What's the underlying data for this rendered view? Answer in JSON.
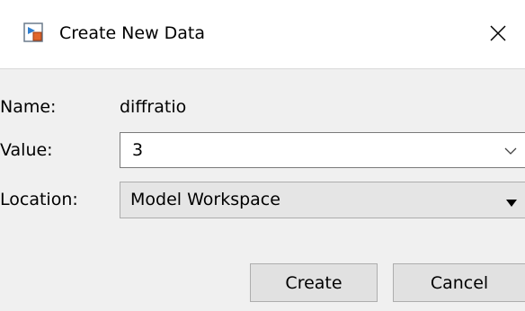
{
  "window": {
    "title": "Create New Data",
    "icon": "simulink-model-icon",
    "close_icon": "close-icon"
  },
  "form": {
    "name_label": "Name:",
    "name_value": "diffratio",
    "value_label": "Value:",
    "value_value": "3",
    "location_label": "Location:",
    "location_value": "Model Workspace"
  },
  "buttons": {
    "create_label": "Create",
    "cancel_label": "Cancel"
  },
  "colors": {
    "title_bg": "#ffffff",
    "dialog_bg": "#f0f0f0",
    "button_bg": "#e1e1e1",
    "dropdown_bg": "#e5e5e5"
  }
}
